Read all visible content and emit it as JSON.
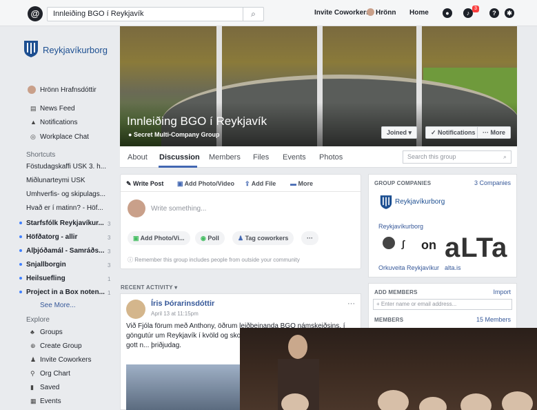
{
  "topbar": {
    "search_value": "Innleiðing BGO í Reykjavík",
    "invite": "Invite Coworkers",
    "user": "Hrönn",
    "home": "Home",
    "notif_count": "3"
  },
  "sidebar": {
    "brand": "Reykjavíkurborg",
    "user_name": "Hrönn Hrafnsdóttir",
    "nav": [
      "News Feed",
      "Notifications",
      "Workplace Chat"
    ],
    "shortcuts_label": "Shortcuts",
    "shortcuts": [
      "Föstudagskaffi USK 3. h...",
      "Miðlunarteymi USK",
      "Umhverfis- og skipulags...",
      "Hvað er í matinn? - Höf..."
    ],
    "groups": [
      {
        "name": "Starfsfólk Reykjavíkur...",
        "count": "3"
      },
      {
        "name": "Höfðatorg - allir",
        "count": "3"
      },
      {
        "name": "Alþjóðamál - Samráðs...",
        "count": "3"
      },
      {
        "name": "Snjallborgin",
        "count": "3"
      },
      {
        "name": "Heilsuefling",
        "count": "1"
      },
      {
        "name": "Project in a Box noten...",
        "count": "1"
      }
    ],
    "see_more": "See More...",
    "explore_label": "Explore",
    "explore": [
      "Groups",
      "Create Group",
      "Invite Coworkers",
      "Org Chart",
      "Saved",
      "Events"
    ]
  },
  "group": {
    "title": "Innleiðing BGO í Reykjavík",
    "subtitle": "Secret Multi-Company Group",
    "joined": "Joined ▾",
    "notifications": "✓ Notifications",
    "more": "··· More"
  },
  "tabs": [
    "About",
    "Discussion",
    "Members",
    "Files",
    "Events",
    "Photos"
  ],
  "tab_search": "Search this group",
  "composer": {
    "actions": [
      "Write Post",
      "Add Photo/Video",
      "Add File",
      "More"
    ],
    "placeholder": "Write something...",
    "pills": [
      "Add Photo/Vi...",
      "Poll",
      "Tag coworkers",
      "···"
    ],
    "note": "Remember this group includes people from outside your community"
  },
  "recent_label": "RECENT ACTIVITY ▾",
  "post": {
    "author": "Íris Þórarinsdóttir",
    "time": "April 13 at 11:15pm",
    "text": "Við Fjóla förum með Anthony, öðrum leiðbeinanda BGO námskeiðsins, í göngutúr um Reykjavík í kvöld og sko... nokkra bari í leiðinni. Við eigum gott n... þriðjudag."
  },
  "companies": {
    "label": "GROUP COMPANIES",
    "count": "3 Companies",
    "brand": "Reykjavíkurborg",
    "link": "Reykjavíkurborg",
    "footer_a": "Orkuveita Reykjavíkur",
    "footer_b": "alta.is"
  },
  "add_members": {
    "label": "ADD MEMBERS",
    "import": "Import",
    "placeholder": "+ Enter name or email address...",
    "members_label": "MEMBERS",
    "members_count": "15 Members"
  }
}
